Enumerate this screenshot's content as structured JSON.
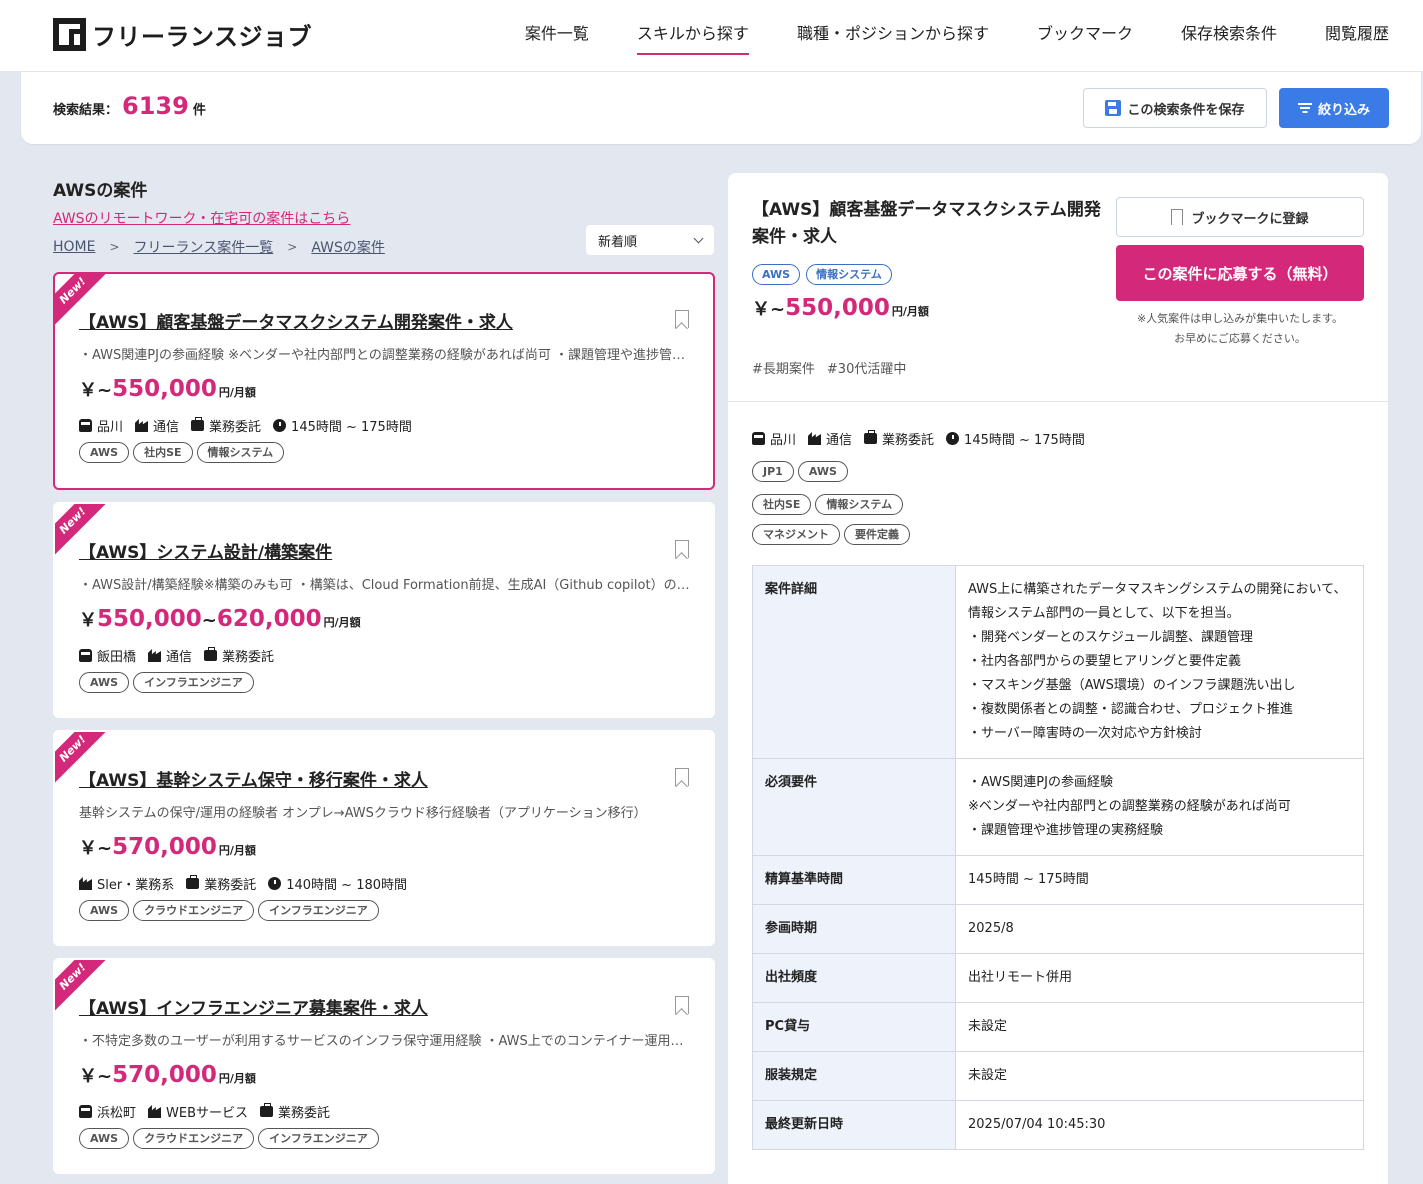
{
  "header": {
    "logo_text": "フリーランスジョブ",
    "nav": [
      "案件一覧",
      "スキルから探す",
      "職種・ポジションから探す",
      "ブックマーク",
      "保存検索条件",
      "閲覧履歴"
    ],
    "active_nav": "スキルから探す"
  },
  "resultbar": {
    "label": "検索結果：",
    "count": "6139",
    "unit": "件",
    "save_search_label": "この検索条件を保存",
    "filter_label": "絞り込み"
  },
  "left": {
    "heading": "AWSの案件",
    "remote_link": "AWSのリモートワーク・在宅可の案件はこちら",
    "breadcrumb": [
      "HOME",
      "フリーランス案件一覧",
      "AWSの案件"
    ],
    "sort_value": "新着順",
    "new_badge": "New!",
    "unit_label": "円/月額",
    "cards": [
      {
        "title": "【AWS】顧客基盤データマスクシステム開発案件・求人",
        "desc": "・AWS関連PJの参画経験 ※ベンダーや社内部門との調整業務の経験があれば尚可 ・課題管理や進捗管理の実務経験",
        "price_prefix": "￥~",
        "price_min": "550,000",
        "price_max": "",
        "station": "品川",
        "industry": "通信",
        "contract": "業務委託",
        "hours": "145時間 ~ 175時間",
        "tags": [
          "AWS",
          "社内SE",
          "情報システム"
        ]
      },
      {
        "title": "【AWS】システム設計/構築案件",
        "desc": "・AWS設計/構築経験※構築のみも可 ・構築は、Cloud Formation前提、生成AI（Github copilot）の利用経験",
        "price_prefix": "￥",
        "price_min": "550,000",
        "price_max": "620,000",
        "station": "飯田橋",
        "industry": "通信",
        "contract": "業務委託",
        "hours": "",
        "tags": [
          "AWS",
          "インフラエンジニア"
        ]
      },
      {
        "title": "【AWS】基幹システム保守・移行案件・求人",
        "desc": "基幹システムの保守/運用の経験者 オンプレ→AWSクラウド移行経験者（アプリケーション移行）",
        "price_prefix": "￥~",
        "price_min": "570,000",
        "price_max": "",
        "station": "",
        "industry": "Sler・業務系",
        "contract": "業務委託",
        "hours": "140時間 ~ 180時間",
        "tags": [
          "AWS",
          "クラウドエンジニア",
          "インフラエンジニア"
        ]
      },
      {
        "title": "【AWS】インフラエンジニア募集案件・求人",
        "desc": "・不特定多数のユーザーが利用するサービスのインフラ保守運用経験 ・AWS上でのコンテイナー運用経験",
        "price_prefix": "￥~",
        "price_min": "570,000",
        "price_max": "",
        "station": "浜松町",
        "industry": "WEBサービス",
        "contract": "業務委託",
        "hours": "",
        "tags": [
          "AWS",
          "クラウドエンジニア",
          "インフラエンジニア"
        ]
      }
    ]
  },
  "detail": {
    "title": "【AWS】顧客基盤データマスクシステム開発案件・求人",
    "tags": [
      "AWS",
      "情報システム"
    ],
    "price_prefix": "￥~",
    "price": "550,000",
    "unit": "円/月額",
    "hashtags": [
      "#長期案件",
      "#30代活躍中"
    ],
    "bookmark_label": "ブックマークに登録",
    "apply_label": "この案件に応募する（無料）",
    "note_line1": "※人気案件は申し込みが集中いたします。",
    "note_line2": "お早めにご応募ください。",
    "station": "品川",
    "industry": "通信",
    "contract": "業務委託",
    "hours": "145時間 ~ 175時間",
    "skill_tags_row1": [
      "JP1",
      "AWS"
    ],
    "skill_tags_row2": [
      "社内SE",
      "情報システム"
    ],
    "skill_tags_row3": [
      "マネジメント",
      "要件定義"
    ],
    "table": [
      {
        "label": "案件詳細",
        "value": "AWS上に構築されたデータマスキングシステムの開発において、\n情報システム部門の一員として、以下を担当。\n・開発ベンダーとのスケジュール調整、課題管理\n・社内各部門からの要望ヒアリングと要件定義\n・マスキング基盤（AWS環境）のインフラ課題洗い出し\n・複数関係者との調整・認識合わせ、プロジェクト推進\n・サーバー障害時の一次対応や方針検討"
      },
      {
        "label": "必須要件",
        "value": "・AWS関連PJの参画経験\n※ベンダーや社内部門との調整業務の経験があれば尚可\n・課題管理や進捗管理の実務経験"
      },
      {
        "label": "精算基準時間",
        "value": "145時間 ~ 175時間"
      },
      {
        "label": "参画時期",
        "value": "2025/8"
      },
      {
        "label": "出社頻度",
        "value": "出社リモート併用"
      },
      {
        "label": "PC貸与",
        "value": "未設定"
      },
      {
        "label": "服装規定",
        "value": "未設定"
      },
      {
        "label": "最終更新日時",
        "value": "2025/07/04 10:45:30"
      }
    ]
  }
}
